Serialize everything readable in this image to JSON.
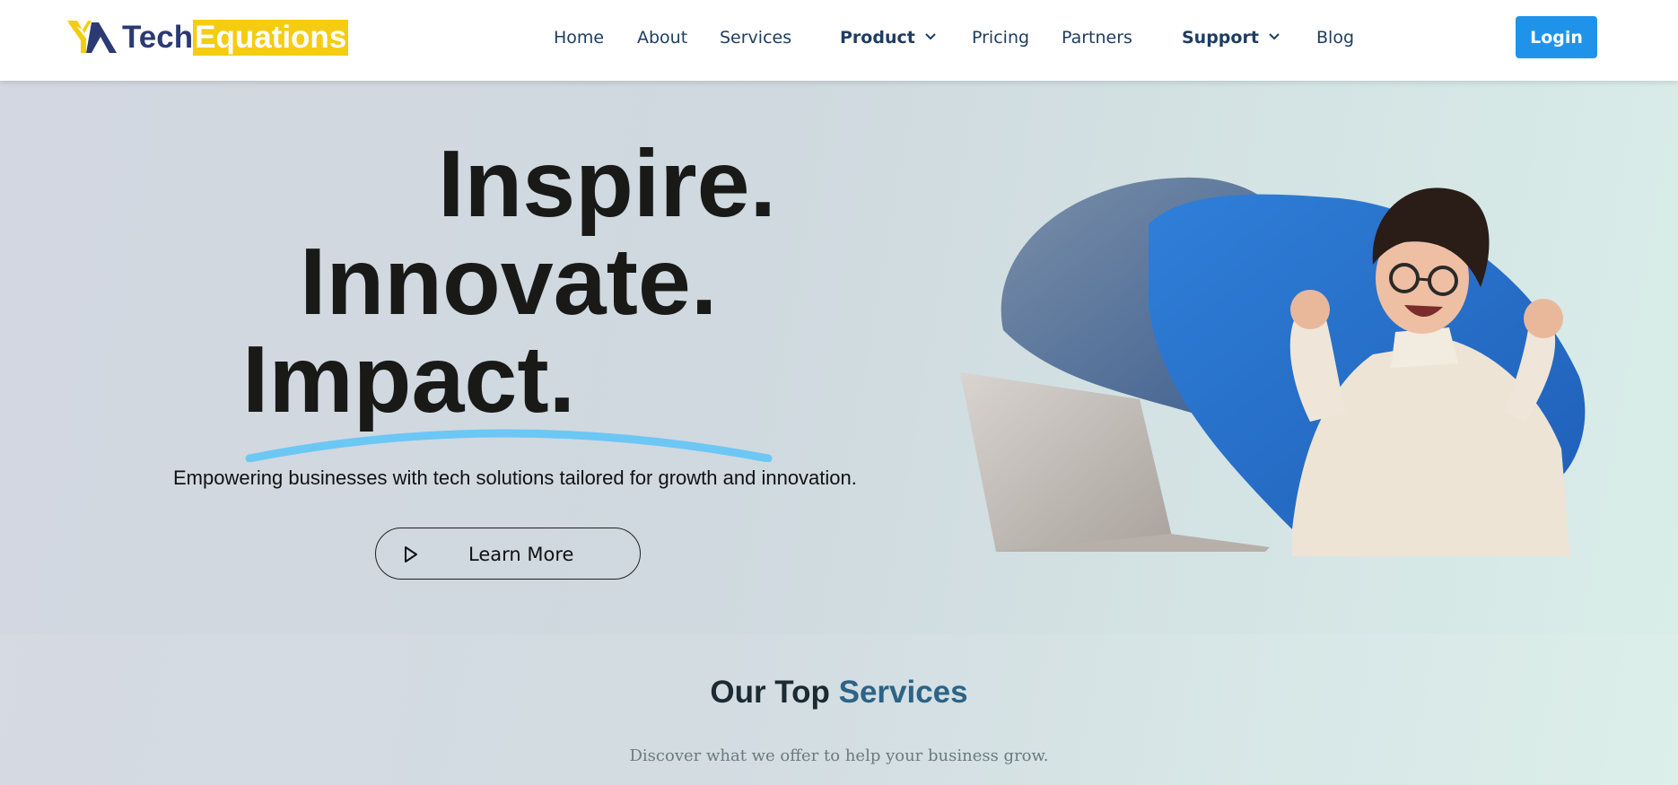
{
  "brand": {
    "name_part1": "Tech",
    "name_part2": "Equations",
    "accent_color": "#f5cc0f",
    "primary_color": "#2b3a73"
  },
  "nav": {
    "home": "Home",
    "about": "About",
    "services": "Services",
    "product": "Product",
    "pricing": "Pricing",
    "partners": "Partners",
    "support": "Support",
    "blog": "Blog",
    "login": "Login"
  },
  "hero": {
    "line1": "Inspire.",
    "line2": "Innovate.",
    "line3": "Impact.",
    "tagline": "Empowering businesses with tech solutions tailored for growth and innovation.",
    "cta_label": "Learn More",
    "underline_color": "#6cc7f5"
  },
  "services": {
    "title_part1": "Our Top",
    "title_part2": "Services",
    "subtitle": "Discover what we offer to help your business grow."
  },
  "icons": {
    "dropdown": "chevron-down-icon",
    "play": "play-icon"
  },
  "colors": {
    "login_button": "#1f93ea",
    "nav_text": "#1e3d61"
  }
}
